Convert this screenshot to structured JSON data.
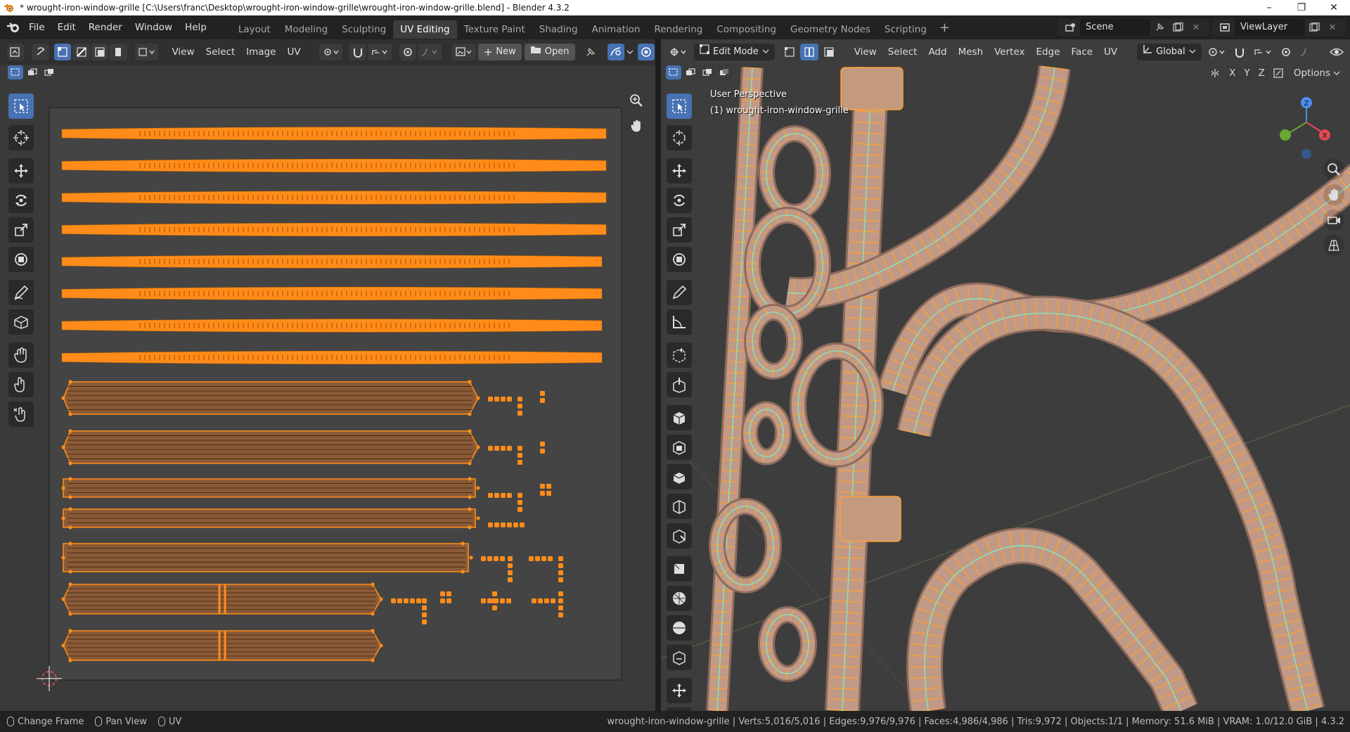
{
  "window": {
    "title": "* wrought-iron-window-grille [C:\\Users\\franc\\Desktop\\wrought-iron-window-grille\\wrought-iron-window-grille.blend] - Blender 4.3.2",
    "minimize": "–",
    "maximize": "❐",
    "close": "✕"
  },
  "menu": [
    "File",
    "Edit",
    "Render",
    "Window",
    "Help"
  ],
  "workspaces": {
    "active": 3,
    "tabs": [
      "Layout",
      "Modeling",
      "Sculpting",
      "UV Editing",
      "Texture Paint",
      "Shading",
      "Animation",
      "Rendering",
      "Compositing",
      "Geometry Nodes",
      "Scripting"
    ],
    "add": "+"
  },
  "scene": {
    "name": "Scene",
    "view_layer": "ViewLayer"
  },
  "uv_editor": {
    "menus": [
      "View",
      "Select",
      "Image",
      "UV"
    ],
    "new_label": "New",
    "open_label": "Open",
    "new_plus": "+"
  },
  "viewport": {
    "mode": "Edit Mode",
    "menus": [
      "View",
      "Select",
      "Add",
      "Mesh",
      "Vertex",
      "Edge",
      "Face",
      "UV"
    ],
    "orientation": "Global",
    "perspective_label": "User Perspective",
    "object_label": "(1) wrought-iron-window-grille",
    "options_label": "Options",
    "axes": [
      "X",
      "Y",
      "Z"
    ],
    "gizmo": {
      "x": "X",
      "y": "Y",
      "z": "Z"
    }
  },
  "status": {
    "left": [
      {
        "key": "Change Frame"
      },
      {
        "key": "Pan View"
      },
      {
        "key": "UV"
      }
    ],
    "right": "wrought-iron-window-grille | Verts:5,016/5,016 | Edges:9,976/9,976 | Faces:4,986/4,986 | Tris:9,972 | Objects:1/1 | Memory: 51.6 MiB | VRAM: 1.0/12.0 GiB | 4.3.2"
  },
  "colors": {
    "accent": "#4772b3",
    "uv_orange": "#ff8c1a",
    "uv_fill": "#8a5a36",
    "mesh_fill": "#c09a86",
    "mesh_edge": "#ffa030",
    "seam": "#7cf0c8"
  }
}
